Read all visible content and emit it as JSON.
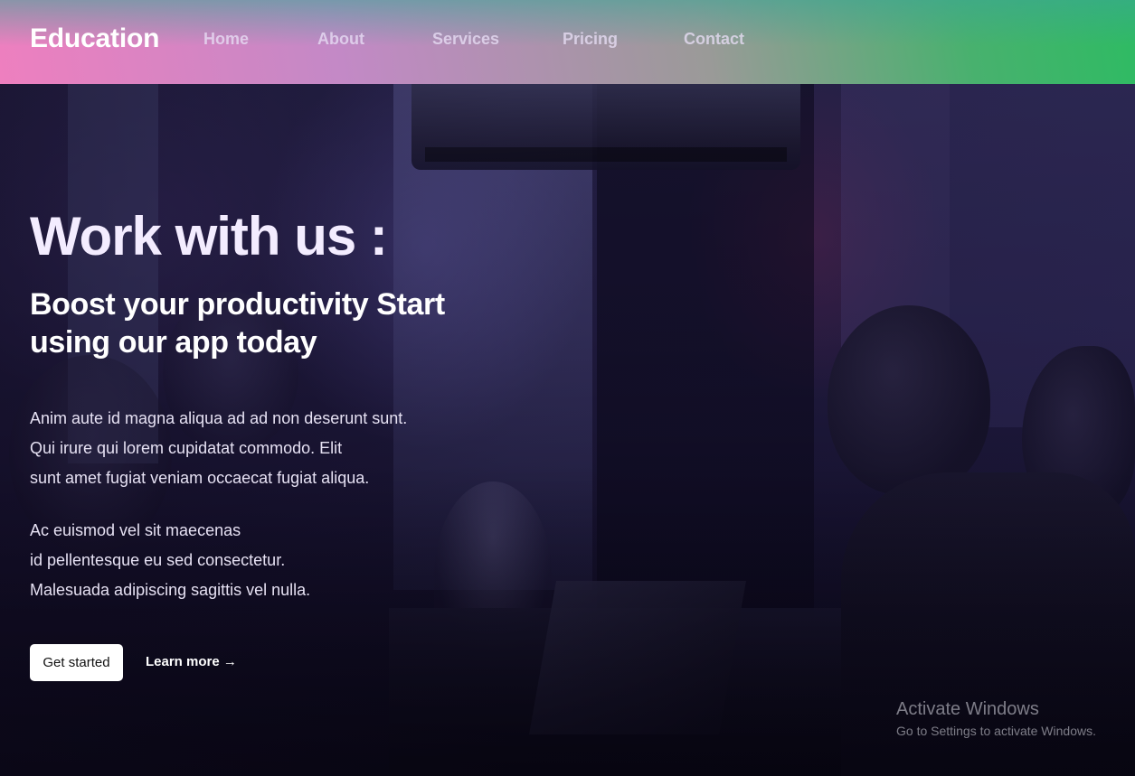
{
  "header": {
    "brand": "Education",
    "nav": [
      {
        "label": "Home"
      },
      {
        "label": "About"
      },
      {
        "label": "Services"
      },
      {
        "label": "Pricing"
      },
      {
        "label": "Contact"
      }
    ]
  },
  "hero": {
    "title": "Work with us :",
    "subtitle": "Boost your productivity Start using our app today",
    "paragraph_1": [
      "Anim aute id magna aliqua ad ad non deserunt sunt.",
      "Qui irure qui lorem cupidatat commodo. Elit",
      "sunt amet fugiat veniam occaecat fugiat aliqua."
    ],
    "paragraph_2": [
      "Ac euismod vel sit maecenas",
      "id pellentesque eu sed consectetur.",
      "Malesuada adipiscing sagittis vel nulla."
    ],
    "cta_primary": "Get started",
    "cta_secondary": "Learn more →"
  },
  "watermark": {
    "title": "Activate Windows",
    "subtitle": "Go to Settings to activate Windows."
  },
  "colors": {
    "header_gradient_start": "#ee7fbf",
    "header_gradient_end": "#2ebb63",
    "hero_overlay": "#231e45",
    "button_bg": "#ffffff"
  }
}
